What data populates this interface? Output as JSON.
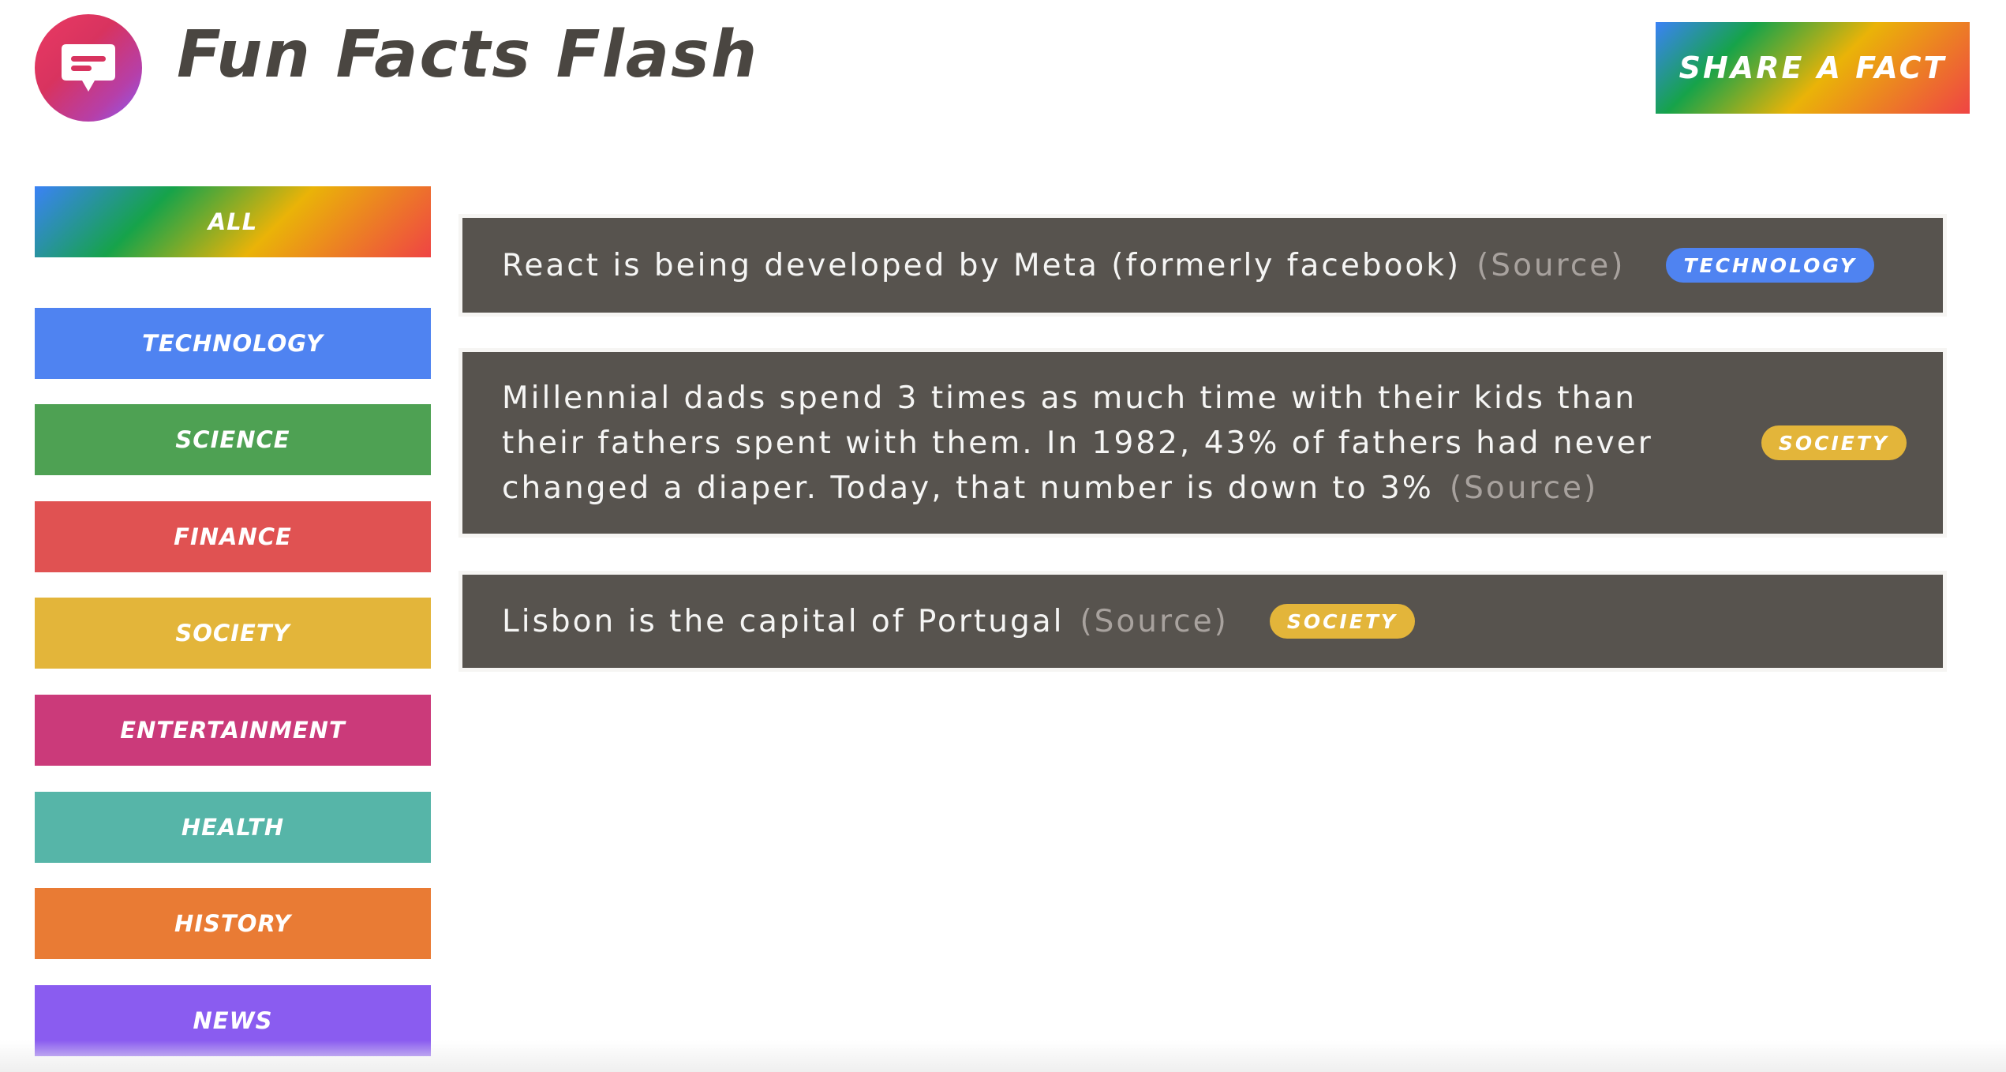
{
  "header": {
    "title": "Fun Facts Flash",
    "share_button": "Share a fact"
  },
  "sidebar": {
    "categories": [
      {
        "label": "All",
        "color": "gradient"
      },
      {
        "label": "Technology",
        "color": "#4f83f1"
      },
      {
        "label": "Science",
        "color": "#4ea153"
      },
      {
        "label": "Finance",
        "color": "#e05252"
      },
      {
        "label": "Society",
        "color": "#e3b53a"
      },
      {
        "label": "Entertainment",
        "color": "#cb3a7a"
      },
      {
        "label": "Health",
        "color": "#56b5a8"
      },
      {
        "label": "History",
        "color": "#e97b34"
      },
      {
        "label": "News",
        "color": "#8a5cf0"
      }
    ]
  },
  "facts": [
    {
      "text": "React is being developed by Meta (formerly facebook)",
      "source_label": "(Source)",
      "category": "Technology"
    },
    {
      "text": "Millennial dads spend 3 times as much time with their kids than their fathers spent with them. In 1982, 43% of fathers had never changed a diaper. Today, that number is down to 3%",
      "source_label": "(Source)",
      "category": "Society"
    },
    {
      "text": "Lisbon is the capital of Portugal",
      "source_label": "(Source)",
      "category": "Society"
    }
  ],
  "icons": {
    "logo": "chat-bubble-icon"
  },
  "colors": {
    "fact_background": "#57534e",
    "title_text": "#4a4641",
    "source_text": "#a8a29e"
  }
}
